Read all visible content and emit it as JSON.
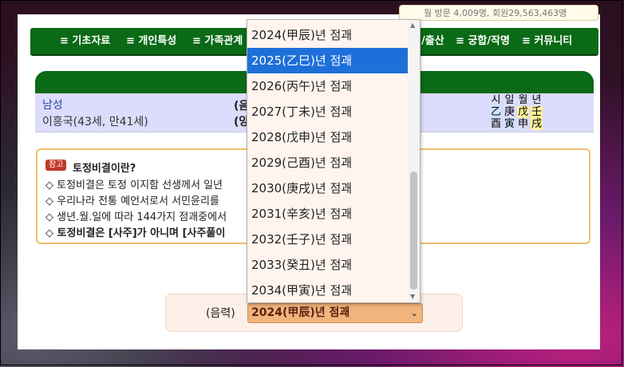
{
  "top_strip": {
    "text": "월 방문 4,009명, 회원29,563,463명"
  },
  "nav": {
    "items": [
      {
        "label": "≡ 기초자료"
      },
      {
        "label": "≡ 개인특성"
      },
      {
        "label": "≡ 가족관계"
      },
      {
        "label": "/출산"
      },
      {
        "label": "≡ 궁합/작명"
      },
      {
        "label": "≡ 커뮤니티"
      }
    ]
  },
  "profile": {
    "gender": "남성",
    "name": "이흥국(43세, 만41세)",
    "lunar_label_1": "(음",
    "lunar_label_2": "(양"
  },
  "saju": {
    "headers": [
      "시",
      "일",
      "월",
      "년"
    ],
    "stems": [
      "乙",
      "庚",
      "戊",
      "壬"
    ],
    "branches": [
      "酉",
      "寅",
      "申",
      "戌"
    ]
  },
  "info": {
    "badge": "참고",
    "title": "토정비결이란?",
    "lines": [
      "◇ 토정비결은 토정 이지함 선생께서 일년",
      "◇ 우리나라 전통 예언서로서 서민윤리를",
      "◇ 생년.월.일에 따라 144가지 점괘중에서",
      "◇ 토정비결은 [사주]가 아니며 [사주풀이"
    ]
  },
  "selector": {
    "label": "(음력)",
    "selected": "2024(甲辰)년 점괘",
    "chevron": "⌄"
  },
  "dropdown": {
    "options": [
      "2024(甲辰)년 점괘",
      "2025(乙巳)년 점괘",
      "2026(丙午)년 점괘",
      "2027(丁未)년 점괘",
      "2028(戊申)년 점괘",
      "2029(己酉)년 점괘",
      "2030(庚戌)년 점괘",
      "2031(辛亥)년 점괘",
      "2032(壬子)년 점괘",
      "2033(癸丑)년 점괘",
      "2034(甲寅)년 점괘"
    ],
    "highlighted": "2025(乙巳)년 점괘",
    "scroll_up": "▲",
    "scroll_down": "▼"
  },
  "colors": {
    "nav_green": "#0a6a16",
    "highlight_blue": "#1e6fd9",
    "select_bg": "#f0b47c"
  }
}
